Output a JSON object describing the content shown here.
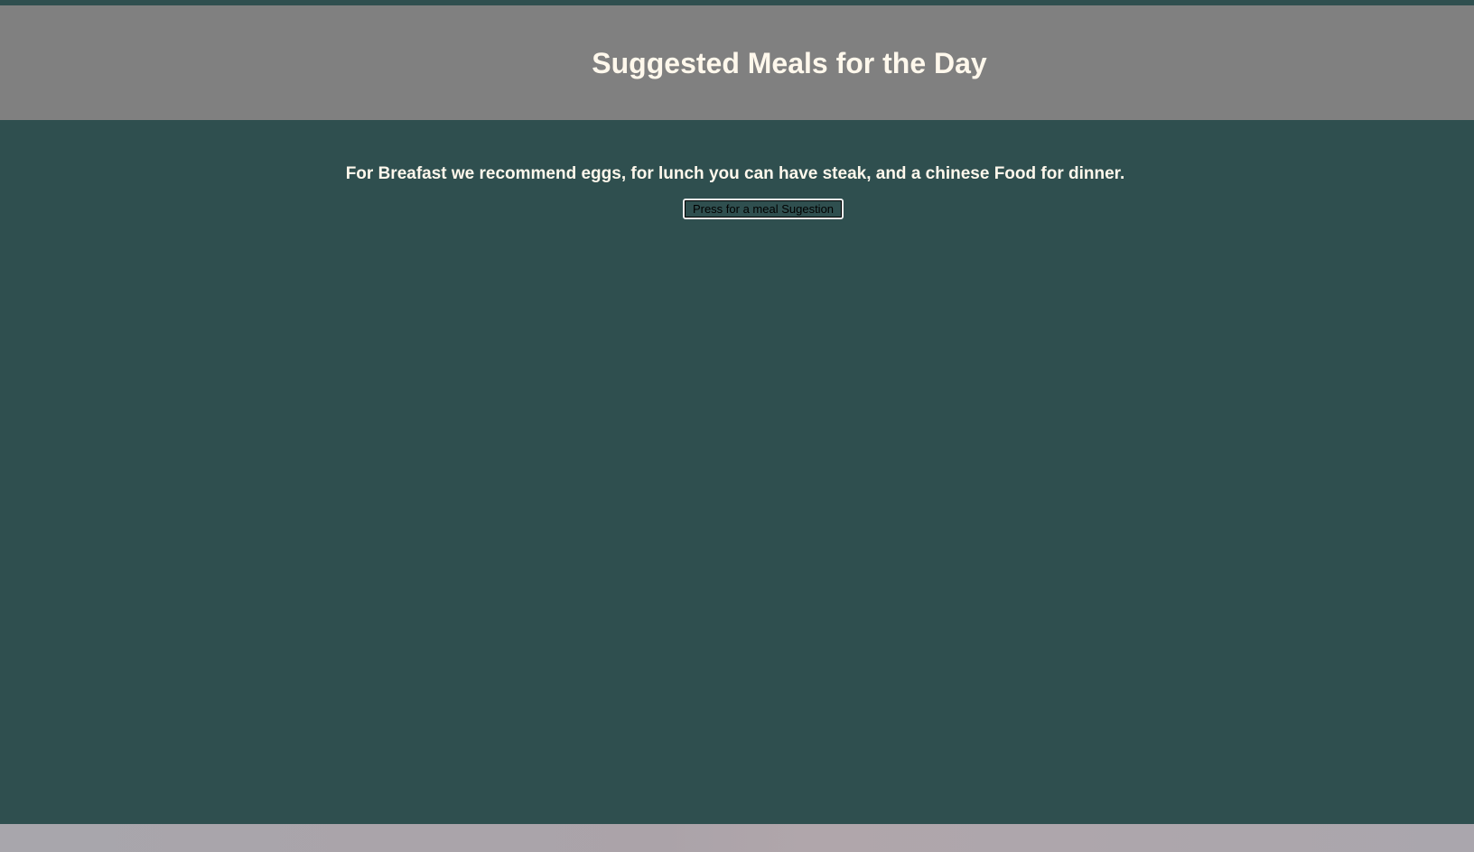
{
  "header": {
    "title": "Suggested Meals for the Day"
  },
  "main": {
    "recommendation": "For Breafast we recommend eggs, for lunch you can have steak, and a chinese Food for dinner.",
    "button_label": "Press for a meal Sugestion"
  },
  "colors": {
    "page_background": "#2f4f4f",
    "header_background": "#808080",
    "text": "#fff8ec",
    "footer_strip": "#aba6ac"
  }
}
